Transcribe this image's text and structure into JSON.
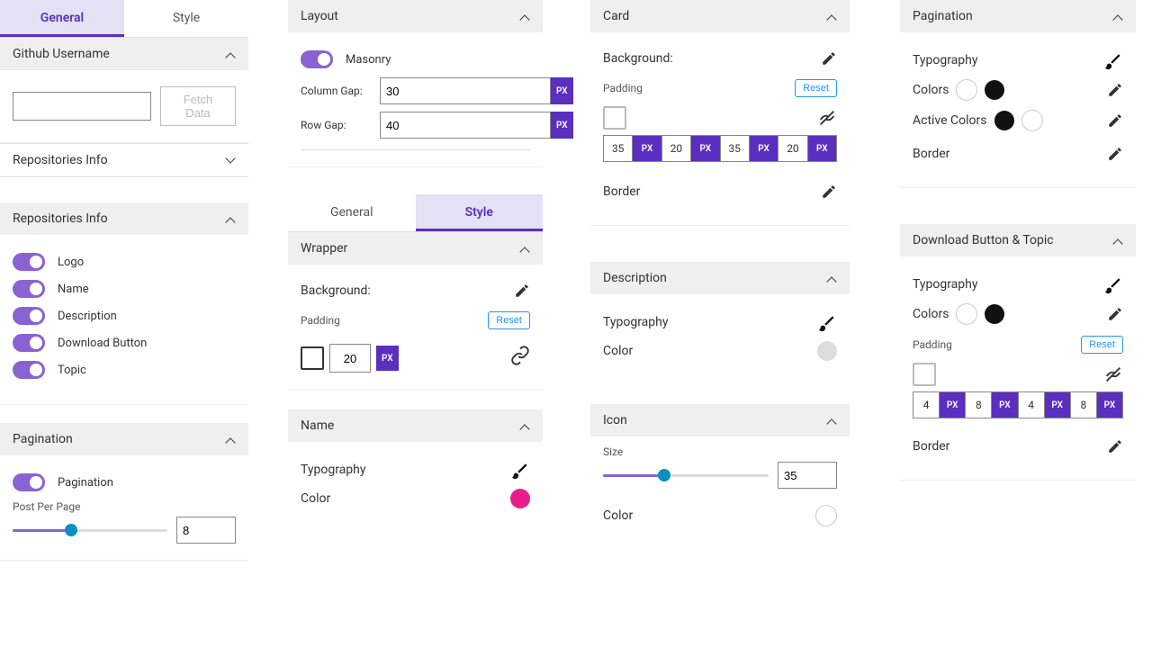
{
  "tabs": {
    "general": "General",
    "style": "Style"
  },
  "github": {
    "heading": "Github Username",
    "value": "",
    "fetch_label": "Fetch Data"
  },
  "repo_info_collapsed_heading": "Repositories Info",
  "repo_info": {
    "heading": "Repositories Info",
    "items": [
      {
        "label": "Logo"
      },
      {
        "label": "Name"
      },
      {
        "label": "Description"
      },
      {
        "label": "Download Button"
      },
      {
        "label": "Topic"
      }
    ]
  },
  "pagination_general": {
    "heading": "Pagination",
    "toggle_label": "Pagination",
    "ppp_label": "Post Per Page",
    "ppp_value": "8"
  },
  "layout": {
    "heading": "Layout",
    "masonry_label": "Masonry",
    "col_gap_label": "Column Gap:",
    "col_gap_value": "30",
    "row_gap_label": "Row Gap:",
    "row_gap_value": "40",
    "unit": "PX"
  },
  "wrapper": {
    "heading": "Wrapper",
    "background_label": "Background:",
    "padding_label": "Padding",
    "reset_label": "Reset",
    "pad_value": "20",
    "unit": "PX"
  },
  "name": {
    "heading": "Name",
    "typography_label": "Typography",
    "color_label": "Color",
    "color_value": "#e91e8e"
  },
  "card": {
    "heading": "Card",
    "background_label": "Background:",
    "padding_label": "Padding",
    "reset_label": "Reset",
    "pad4": [
      "35",
      "20",
      "35",
      "20"
    ],
    "unit": "PX",
    "border_label": "Border"
  },
  "description_sec": {
    "heading": "Description",
    "typography_label": "Typography",
    "color_label": "Color"
  },
  "icon": {
    "heading": "Icon",
    "size_label": "Size",
    "size_value": "35",
    "color_label": "Color"
  },
  "pag_style": {
    "heading": "Pagination",
    "typography_label": "Typography",
    "colors_label": "Colors",
    "active_colors_label": "Active Colors",
    "border_label": "Border"
  },
  "dlbtn": {
    "heading": "Download Button & Topic",
    "typography_label": "Typography",
    "colors_label": "Colors",
    "padding_label": "Padding",
    "reset_label": "Reset",
    "pad4": [
      "4",
      "8",
      "4",
      "8"
    ],
    "unit": "PX",
    "border_label": "Border"
  }
}
